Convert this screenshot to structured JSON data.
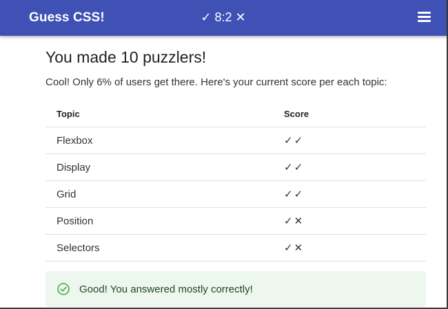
{
  "appbar": {
    "title": "Guess CSS!",
    "score": {
      "correct_icon": "✓",
      "correct": "8",
      "separator": ":",
      "wrong": "2",
      "wrong_icon": "✕"
    },
    "menu_icon": "hamburger-menu-icon"
  },
  "main": {
    "heading": "You made 10 puzzlers!",
    "intro": "Cool! Only 6% of users get there. Here's your current score per each topic:",
    "table": {
      "headers": [
        "Topic",
        "Score"
      ],
      "rows": [
        {
          "topic": "Flexbox",
          "score": "✓✓"
        },
        {
          "topic": "Display",
          "score": "✓✓"
        },
        {
          "topic": "Grid",
          "score": "✓✓"
        },
        {
          "topic": "Position",
          "score": "✓✕"
        },
        {
          "topic": "Selectors",
          "score": "✓✕"
        }
      ]
    },
    "alert": {
      "icon": "check-circle-icon",
      "text": "Good! You answered mostly correctly!"
    }
  },
  "colors": {
    "appbar": "#3f51b5",
    "alert_background": "#edf7ed",
    "alert_text": "#1e4620",
    "alert_icon": "#4caf50"
  }
}
